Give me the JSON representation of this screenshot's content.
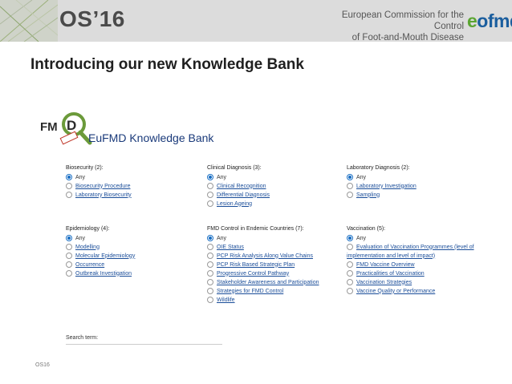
{
  "header": {
    "title": "OS’16",
    "org_line1": "European Commission for the Control",
    "org_line2": "of Foot-and-Mouth Disease",
    "logo_e": "e",
    "logo_rest": "ofmd"
  },
  "slide": {
    "title": "Introducing our new Knowledge Bank"
  },
  "kb": {
    "logo_text": "FM",
    "title": "EuFMD Knowledge Bank",
    "groups": [
      {
        "heading": "Biosecurity (2):",
        "options": [
          "Any",
          "Biosecurity Procedure",
          "Laboratory Biosecurity"
        ]
      },
      {
        "heading": "Clinical Diagnosis (3):",
        "options": [
          "Any",
          "Clinical Recognition",
          "Differential Diagnosis",
          "Lesion Ageing"
        ]
      },
      {
        "heading": "Laboratory Diagnosis (2):",
        "options": [
          "Any",
          "Laboratory Investigation",
          "Sampling"
        ]
      },
      {
        "heading": "Epidemiology (4):",
        "options": [
          "Any",
          "Modelling",
          "Molecular Epidemiology",
          "Occurrence",
          "Outbreak Investigation"
        ]
      },
      {
        "heading": "FMD Control in Endemic Countries (7):",
        "options": [
          "Any",
          "OIE Status",
          "PCP Risk Analysis Along Value Chains",
          "PCP Risk Based Strategic Plan",
          "Progressive Control Pathway",
          "Stakeholder Awareness and Participation",
          "Strategies for FMD Control",
          "Wildlife"
        ]
      },
      {
        "heading": "Vaccination (5):",
        "options": [
          "Any",
          "Evaluation of Vaccination Programmes (level of",
          "implementation and level of impact)",
          "FMD Vaccine Overview",
          "Practicalities of Vaccination",
          "Vaccination Strategies",
          "Vaccine Quality or Performance"
        ]
      }
    ],
    "search_label": "Search term:"
  },
  "footer": {
    "text": "OS16"
  },
  "colors": {
    "header_bg": "#dcdcdc",
    "link": "#1a4d99",
    "logo_blue": "#1b5e9e",
    "logo_green": "#5aa531"
  }
}
